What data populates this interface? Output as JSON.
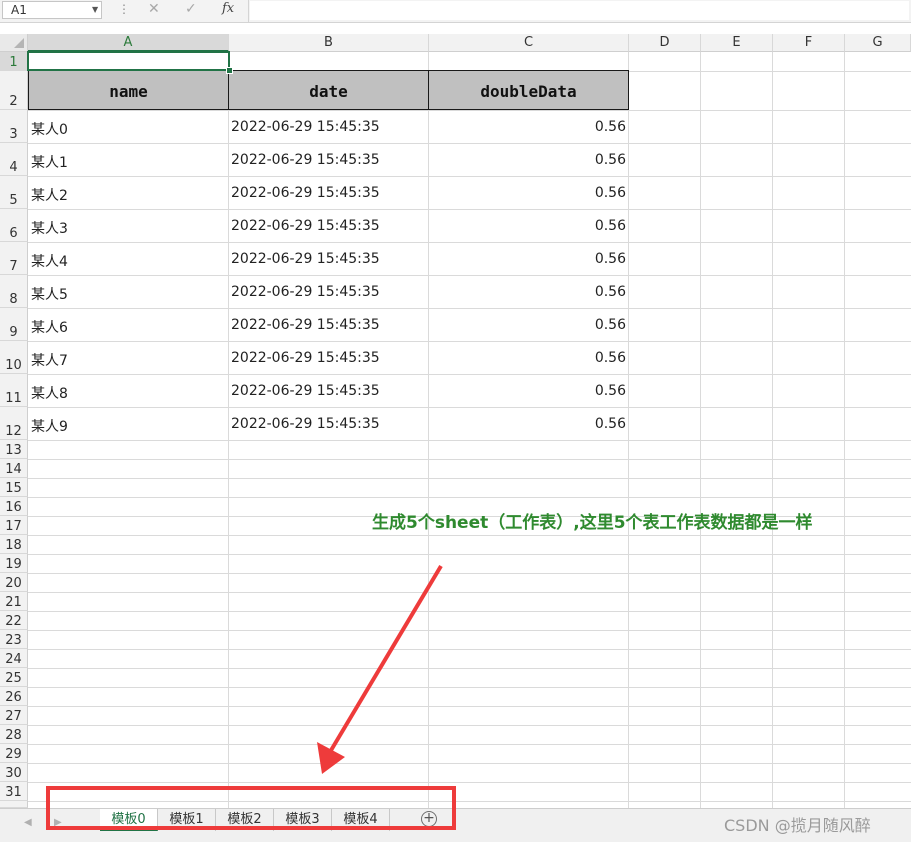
{
  "formula_bar": {
    "name_box": "A1",
    "fx": "fx"
  },
  "columns": [
    "A",
    "B",
    "C",
    "D",
    "E",
    "F",
    "G"
  ],
  "rows": [
    "1",
    "2",
    "3",
    "4",
    "5",
    "6",
    "7",
    "8",
    "9",
    "10",
    "11",
    "12",
    "13",
    "14",
    "15",
    "16",
    "17",
    "18",
    "19",
    "20",
    "21",
    "22",
    "23",
    "24",
    "25",
    "26",
    "27",
    "28",
    "29",
    "30",
    "31"
  ],
  "table": {
    "headers": [
      "name",
      "date",
      "doubleData"
    ],
    "rows": [
      [
        "某人0",
        "2022-06-29 15:45:35",
        "0.56"
      ],
      [
        "某人1",
        "2022-06-29 15:45:35",
        "0.56"
      ],
      [
        "某人2",
        "2022-06-29 15:45:35",
        "0.56"
      ],
      [
        "某人3",
        "2022-06-29 15:45:35",
        "0.56"
      ],
      [
        "某人4",
        "2022-06-29 15:45:35",
        "0.56"
      ],
      [
        "某人5",
        "2022-06-29 15:45:35",
        "0.56"
      ],
      [
        "某人6",
        "2022-06-29 15:45:35",
        "0.56"
      ],
      [
        "某人7",
        "2022-06-29 15:45:35",
        "0.56"
      ],
      [
        "某人8",
        "2022-06-29 15:45:35",
        "0.56"
      ],
      [
        "某人9",
        "2022-06-29 15:45:35",
        "0.56"
      ]
    ]
  },
  "annotation": "生成5个sheet（工作表）,这里5个表工作表数据都是一样",
  "sheet_tabs": [
    "模板0",
    "模板1",
    "模板2",
    "模板3",
    "模板4"
  ],
  "active_tab": "模板0",
  "watermark": "CSDN @揽月随风醉",
  "colors": {
    "accent": "#217346",
    "annotation": "#2f8a2f",
    "highlight_box": "#ee3b3b",
    "header_fill": "#c0c0c0"
  }
}
